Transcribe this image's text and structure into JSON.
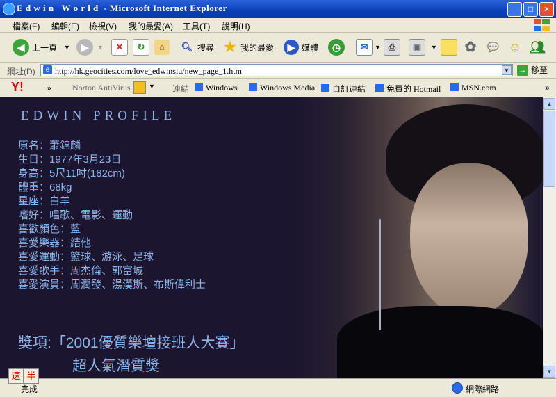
{
  "window": {
    "title": "E d w i n   W o r l d  - Microsoft Internet Explorer",
    "controls": [
      "_",
      "□",
      "×"
    ]
  },
  "menu": [
    "檔案(F)",
    "編輯(E)",
    "檢視(V)",
    "我的最愛(A)",
    "工具(T)",
    "說明(H)"
  ],
  "toolbar": {
    "back_label": "上一頁",
    "search_label": "搜尋",
    "favorites_label": "我的最愛",
    "media_label": "媒體"
  },
  "address": {
    "label": "網址(D)",
    "url": "http://hk.geocities.com/love_edwinsiu/new_page_1.htm",
    "go_label": "移至"
  },
  "links": {
    "chevron": "»",
    "norton": "Norton AntiVirus",
    "links_label": "連結",
    "items": [
      "Windows",
      "Windows Media",
      "自訂連結",
      "免費的 Hotmail",
      "MSN.com"
    ]
  },
  "page": {
    "heading": "EDWIN PROFILE",
    "profile": [
      "原名：蕭錦麟",
      "生日：1977年3月23日",
      "身高：5尺11吋(182cm)",
      "體重：68kg",
      "星座：白羊",
      "嗜好：唱歌、電影、運動",
      "喜歡顏色：藍",
      "喜愛樂器：結他",
      "喜愛運動：籃球、游泳、足球",
      "喜愛歌手：周杰倫、郭富城",
      "喜愛演員：周潤發、湯漢斯、布斯偉利士"
    ],
    "award_line1": "獎項:「2001優質樂壇接班人大賽」",
    "award_line2": "超人氣潛質獎"
  },
  "ime": [
    "速",
    "半"
  ],
  "status": {
    "left_text": "完成",
    "zone": "網際網路"
  },
  "colors": {
    "page_bg": "#1b1530",
    "text": "#8db4e6",
    "titlebar": "#0a3fb8"
  }
}
